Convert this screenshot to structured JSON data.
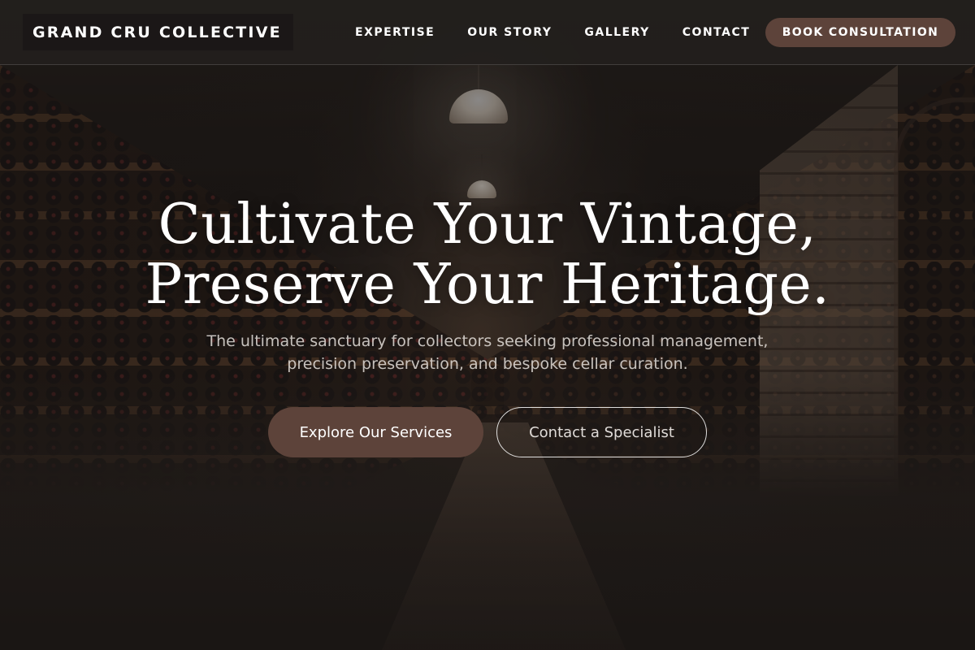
{
  "header": {
    "brand": "GRAND CRU COLLECTIVE",
    "nav": [
      {
        "label": "EXPERTISE"
      },
      {
        "label": "OUR STORY"
      },
      {
        "label": "GALLERY"
      },
      {
        "label": "CONTACT"
      }
    ],
    "cta_label": "BOOK CONSULTATION"
  },
  "hero": {
    "title_line1": "Cultivate Your Vintage,",
    "title_line2": "Preserve Your Heritage.",
    "subtitle_line1": "The ultimate sanctuary for collectors seeking professional management,",
    "subtitle_line2": "precision preservation, and bespoke cellar curation.",
    "primary_button": "Explore Our Services",
    "secondary_button": "Contact a Specialist"
  },
  "colors": {
    "accent": "#5d433a",
    "header_bg": "#231f1d",
    "text": "#ffffff"
  }
}
